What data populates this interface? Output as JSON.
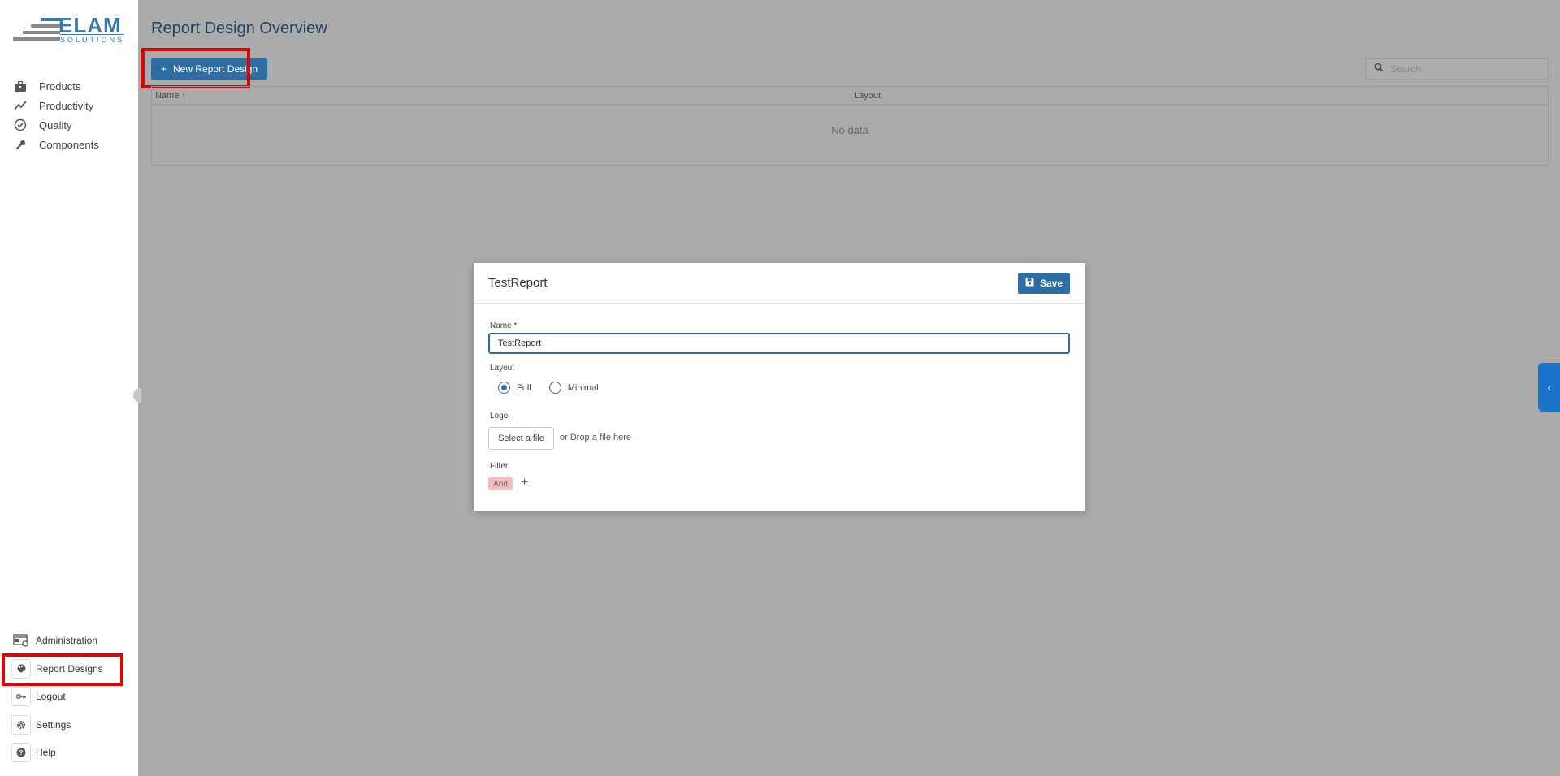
{
  "sidebar": {
    "logo": {
      "text": "ELAM",
      "sub": "SOLUTIONS"
    },
    "items": [
      {
        "label": "Products",
        "icon": "briefcase-icon"
      },
      {
        "label": "Productivity",
        "icon": "trend-line-icon"
      },
      {
        "label": "Quality",
        "icon": "check-circle-icon"
      },
      {
        "label": "Components",
        "icon": "wrench-icon"
      }
    ],
    "bottom_items": [
      {
        "label": "Administration",
        "icon": "admin-panel-icon"
      },
      {
        "label": "Report Designs",
        "icon": "palette-icon"
      },
      {
        "label": "Logout",
        "icon": "key-icon"
      },
      {
        "label": "Settings",
        "icon": "gear-icon"
      },
      {
        "label": "Help",
        "icon": "help-icon"
      }
    ]
  },
  "page": {
    "title": "Report Design Overview",
    "new_button_label": "New Report Design",
    "search_placeholder": "Search",
    "columns": {
      "name": "Name",
      "layout": "Layout"
    },
    "empty_text": "No data"
  },
  "dialog": {
    "title": "TestReport",
    "save_label": "Save",
    "name_label": "Name *",
    "name_value": "TestReport",
    "layout_label": "Layout",
    "layout_options": [
      "Full",
      "Minimal"
    ],
    "layout_selected": "Full",
    "logo_label": "Logo",
    "select_file_label": "Select a file",
    "drop_text": "or Drop a file here",
    "filter_label": "Filter",
    "filter_chip": "And",
    "add_filter": "+"
  },
  "colors": {
    "accent": "#2e6da4",
    "highlight": "#e00000",
    "overlay": "#ababab"
  }
}
